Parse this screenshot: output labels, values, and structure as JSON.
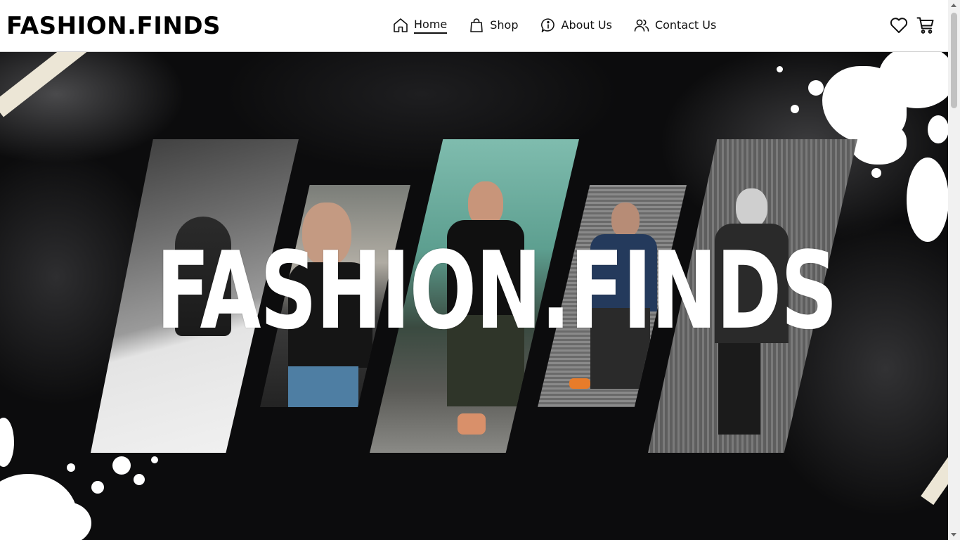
{
  "brand": {
    "logo": "FASHION.FINDS"
  },
  "nav": {
    "items": [
      {
        "label": "Home",
        "icon": "home-icon",
        "active": true
      },
      {
        "label": "Shop",
        "icon": "shopping-bag-icon",
        "active": false
      },
      {
        "label": "About Us",
        "icon": "info-icon",
        "active": false
      },
      {
        "label": "Contact Us",
        "icon": "users-icon",
        "active": false
      }
    ]
  },
  "header_actions": {
    "wishlist_icon": "heart-icon",
    "cart_icon": "cart-icon"
  },
  "hero": {
    "title": "FASHION.FINDS"
  },
  "colors": {
    "header_bg": "#ffffff",
    "hero_bg": "#0c0c0d",
    "text": "#111111",
    "accent_white": "#ffffff"
  }
}
